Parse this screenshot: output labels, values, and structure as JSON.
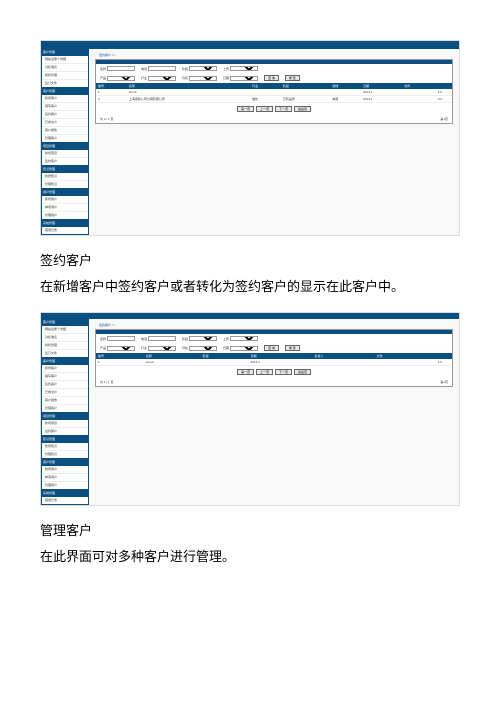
{
  "doc": {
    "heading1": "签约客户",
    "paragraph1": "在新增客户中签约客户或者转化为签约客户的显示在此客户中。",
    "heading2": "管理客户",
    "paragraph2": "在此界面可对多种客户进行管理。"
  },
  "app": {
    "crumb": "签约客户 >>",
    "crumb2": "签约客户 >>",
    "sidebar": {
      "groups": [
        {
          "header": "客户管理",
          "items": [
            "网站注册个详细",
            "对标准表",
            "树状管理",
            "签订文件"
          ]
        },
        {
          "header": "客户管理",
          "items": [
            "新增客户",
            "填写客户",
            "签约客户",
            "已成交户",
            "客户报告",
            "管理客户"
          ]
        },
        {
          "header": "项目管理",
          "items": [
            "新增项目",
            "签约客户"
          ]
        },
        {
          "header": "知识管理",
          "items": [
            "新增知识",
            "管理知识"
          ]
        },
        {
          "header": "用户管理",
          "items": [
            "新增用户",
            "单项用户",
            "管理用户"
          ]
        },
        {
          "header": "系统管理",
          "items": [
            "错误日志"
          ]
        }
      ]
    },
    "search": {
      "fields": {
        "name_label": "名称",
        "name_value": "",
        "phone_label": "电话",
        "phone_value": "",
        "prod_label": "产品",
        "prod_value": "",
        "stage_label": "阶段",
        "stage_value": "",
        "industry_label": "行业",
        "industry_value": "",
        "origin_label": "上传",
        "origin_value": "",
        "month_label": "月初",
        "month_value": "",
        "time_label": "日期",
        "time_value": ""
      },
      "btn_query": "查 询",
      "btn_reset": "重 置"
    },
    "table": {
      "headers": [
        "编号",
        "名称",
        "行业",
        "阶段",
        "建档",
        "日期",
        "文件"
      ],
      "rows": [
        [
          "1",
          "emoA",
          "",
          "",
          "",
          "2014-1",
          "1.0"
        ],
        [
          "2",
          "上海康新公司分销有限公司",
          "餐饮",
          "已有品牌",
          "本部",
          "2014-1",
          "0.0"
        ]
      ],
      "footer_left": "共 2 / 1 页",
      "footer_right": "第1页"
    },
    "table2": {
      "headers": [
        "编号",
        "名称",
        "阶段",
        "日期",
        "负责人",
        "文件"
      ],
      "rows": [
        [
          "1",
          "emoA",
          "",
          "2014-1",
          "",
          "1.0"
        ]
      ],
      "footer_left": "共 1 / 1 页",
      "footer_right": "第1页"
    },
    "pager": {
      "first": "第一页",
      "prev": "上一页",
      "next": "下一页",
      "last": "最后页"
    }
  }
}
